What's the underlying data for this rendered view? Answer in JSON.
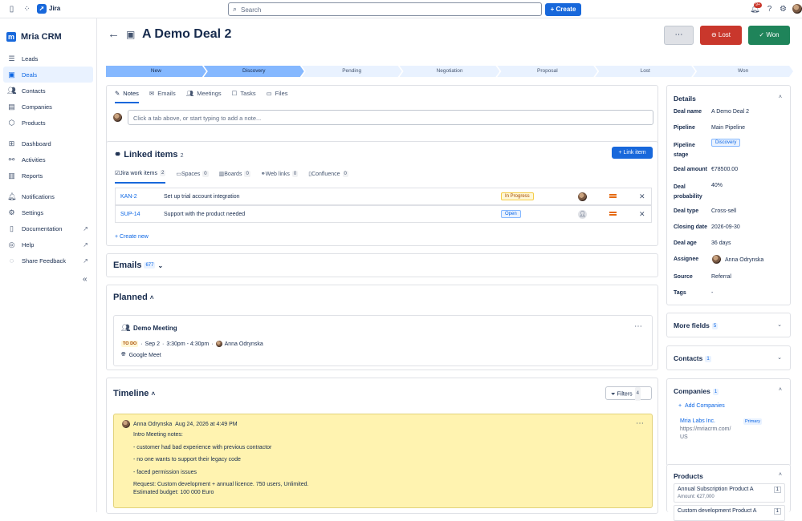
{
  "topbar": {
    "app_name": "Jira",
    "search_placeholder": "Search",
    "create_label": "Create",
    "notif_badge": "9+"
  },
  "sidebar": {
    "brand": "Mria CRM",
    "items": [
      {
        "label": "Leads",
        "icon": "list-icon"
      },
      {
        "label": "Deals",
        "icon": "deal-icon"
      },
      {
        "label": "Contacts",
        "icon": "people-icon"
      },
      {
        "label": "Companies",
        "icon": "building-icon"
      },
      {
        "label": "Products",
        "icon": "box-icon"
      },
      {
        "label": "Dashboard",
        "icon": "dashboard-icon"
      },
      {
        "label": "Activities",
        "icon": "activity-icon"
      },
      {
        "label": "Reports",
        "icon": "chart-icon"
      },
      {
        "label": "Notifications",
        "icon": "bell-icon"
      },
      {
        "label": "Settings",
        "icon": "gear-icon"
      },
      {
        "label": "Documentation",
        "icon": "doc-icon"
      },
      {
        "label": "Help",
        "icon": "help-icon"
      },
      {
        "label": "Share Feedback",
        "icon": "feedback-icon"
      }
    ]
  },
  "deal": {
    "title": "A Demo Deal 2",
    "more_label": "⋯",
    "lost_label": "Lost",
    "won_label": "Won",
    "stages": [
      "New",
      "Discovery",
      "Pending",
      "Negotiation",
      "Proposal",
      "Lost",
      "Won"
    ]
  },
  "notes": {
    "tabs": [
      "Notes",
      "Emails",
      "Meetings",
      "Tasks",
      "Files"
    ],
    "placeholder": "Click a tab above, or start typing to add a note..."
  },
  "linked": {
    "title": "Linked items",
    "count": "2",
    "link_label": "Link item",
    "tabs": [
      {
        "label": "Jira work items",
        "count": "2"
      },
      {
        "label": "Spaces",
        "count": "0"
      },
      {
        "label": "Boards",
        "count": "0"
      },
      {
        "label": "Web links",
        "count": "0"
      },
      {
        "label": "Confluence",
        "count": "0"
      }
    ],
    "rows": [
      {
        "key": "KAN-2",
        "summary": "Set up trial account integration",
        "status": "In Progress"
      },
      {
        "key": "SUP-14",
        "summary": "Support with the product needed",
        "status": "Open"
      }
    ],
    "create_new": "Create new"
  },
  "emails": {
    "title": "Emails",
    "count": "677"
  },
  "planned": {
    "title": "Planned",
    "meeting_title": "Demo Meeting",
    "todo": "TO DO",
    "date": "Sep 2",
    "time": "3:30pm - 4:30pm",
    "person": "Anna Odrynska",
    "location": "Google Meet"
  },
  "timeline": {
    "title": "Timeline",
    "filters_label": "Filters",
    "filters_count": "4",
    "entry": {
      "author": "Anna Odrynska",
      "date": "Aug 24, 2026 at 4:49 PM",
      "lines": [
        "Intro Meeting notes:",
        "- customer had bad experience with previous contractor",
        "- no one wants to support their legacy code",
        "- faced permission issues",
        "Request: Custom development + annual licence. 750 users, Unlimited.",
        "Estimated budget: 100 000 Euro"
      ]
    }
  },
  "details": {
    "title": "Details",
    "fields": [
      {
        "label": "Deal name",
        "value": "A Demo Deal 2"
      },
      {
        "label": "Pipeline",
        "value": "Main Pipeline"
      },
      {
        "label": "Pipeline stage",
        "value": "Discovery"
      },
      {
        "label": "Deal amount",
        "value": "€78500.00"
      },
      {
        "label": "Deal probability",
        "value": "40%"
      },
      {
        "label": "Deal type",
        "value": "Cross-sell"
      },
      {
        "label": "Closing date",
        "value": "2026-09-30"
      },
      {
        "label": "Deal age",
        "value": "36 days"
      },
      {
        "label": "Assignee",
        "value": "Anna Odrynska"
      },
      {
        "label": "Source",
        "value": "Referral"
      },
      {
        "label": "Tags",
        "value": "-"
      }
    ]
  },
  "more_fields": {
    "title": "More fields",
    "count": "5"
  },
  "contacts": {
    "title": "Contacts",
    "count": "1"
  },
  "companies": {
    "title": "Companies",
    "count": "1",
    "add_label": "Add Companies",
    "name": "Mria Labs Inc.",
    "badge": "Primary",
    "url": "https://mriacrm.com/",
    "country": "US"
  },
  "products": {
    "title": "Products",
    "items": [
      {
        "name": "Annual Subscription Product A",
        "amount": "Amount: €27,000",
        "qty": "1"
      },
      {
        "name": "Custom development Product A",
        "amount": "",
        "qty": "1"
      }
    ]
  }
}
